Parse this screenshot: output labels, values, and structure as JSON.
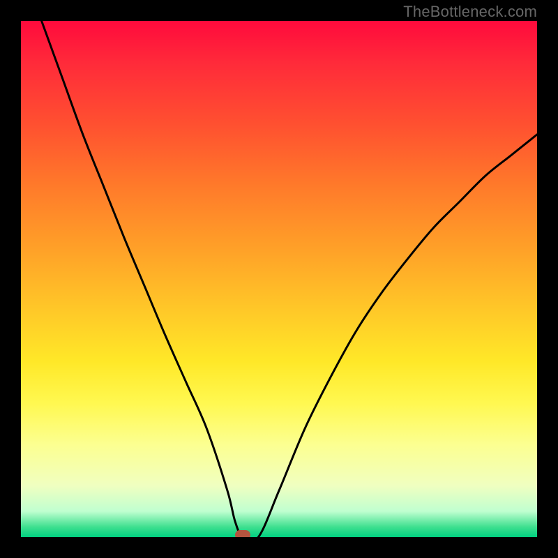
{
  "watermark": "TheBottleneck.com",
  "marker_color": "#b5543f",
  "chart_data": {
    "type": "line",
    "title": "",
    "xlabel": "",
    "ylabel": "",
    "xlim": [
      0,
      100
    ],
    "ylim": [
      0,
      100
    ],
    "grid": false,
    "legend": false,
    "series": [
      {
        "name": "bottleneck-curve",
        "x": [
          4,
          8,
          12,
          16,
          20,
          24,
          28,
          32,
          36,
          40,
          41.5,
          43,
          46,
          50,
          55,
          60,
          65,
          70,
          75,
          80,
          85,
          90,
          95,
          100
        ],
        "y": [
          100,
          89,
          78,
          68,
          58,
          48.5,
          39,
          30,
          21,
          9,
          3,
          0,
          0,
          9,
          21,
          31,
          40,
          47.5,
          54,
          60,
          65,
          70,
          74,
          78
        ]
      }
    ],
    "annotations": [
      {
        "type": "marker",
        "x": 43,
        "y": 0,
        "label": "optimal-point"
      }
    ],
    "background_gradient_note": "vertical hue scale: top=high bottleneck (red), bottom=low bottleneck (green)"
  }
}
